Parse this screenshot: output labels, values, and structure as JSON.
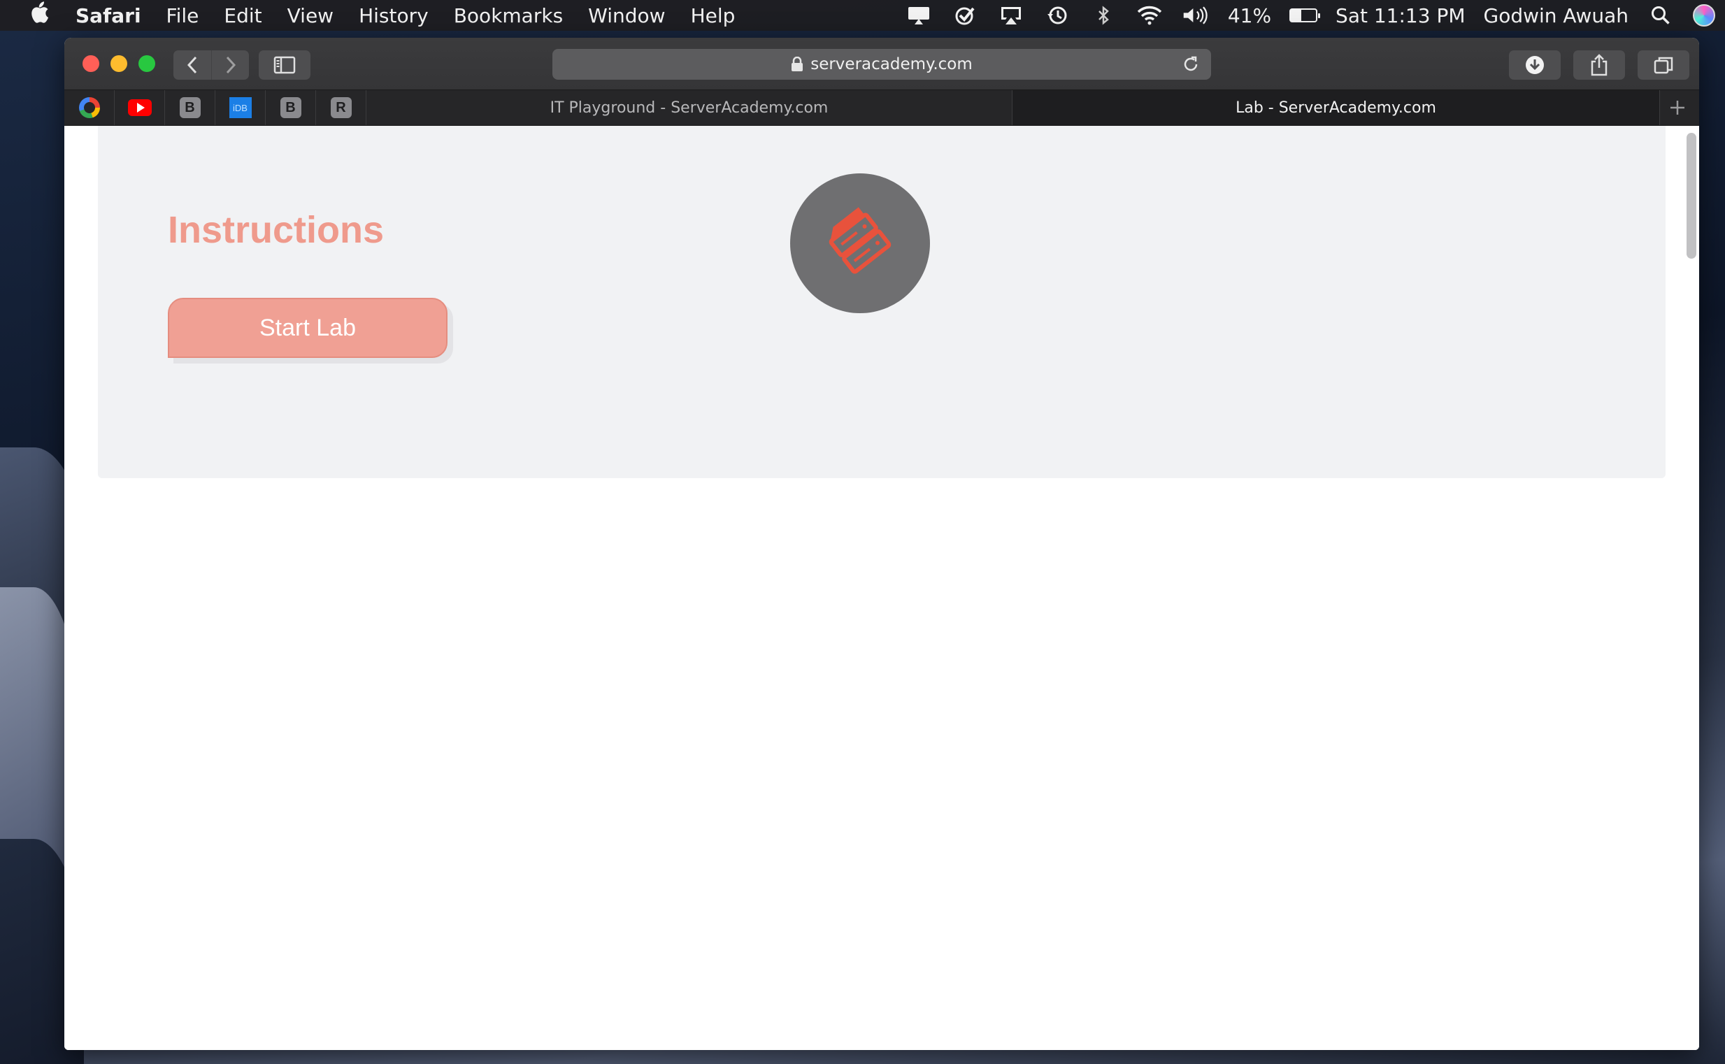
{
  "menubar": {
    "app_name": "Safari",
    "items": [
      "File",
      "Edit",
      "View",
      "History",
      "Bookmarks",
      "Window",
      "Help"
    ],
    "battery_percent": "41%",
    "clock": "Sat 11:13 PM",
    "user_name": "Godwin Awuah",
    "battery_level": 0.41
  },
  "toolbar": {
    "url": "serveracademy.com"
  },
  "tabs": {
    "pinned": [
      "google-icon",
      "youtube-icon",
      "B",
      "iDB",
      "B",
      "R"
    ],
    "pinned_letters": {
      "b1": "B",
      "idb": "iDB",
      "b2": "B",
      "r": "R"
    },
    "items": [
      {
        "label": "IT Playground - ServerAcademy.com",
        "active": false
      },
      {
        "label": "Lab - ServerAcademy.com",
        "active": true
      }
    ],
    "new_tab_symbol": "+"
  },
  "page": {
    "heading": "Instructions",
    "start_button_label": "Start Lab"
  },
  "colors": {
    "accent": "#ef9a8c",
    "button": "#f0a094",
    "logo_circle": "#6f6f71",
    "logo_mark": "#e8523c"
  }
}
